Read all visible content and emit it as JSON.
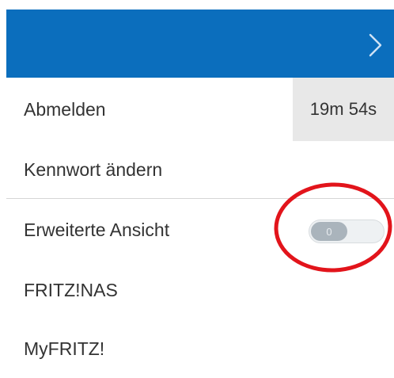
{
  "header": {
    "bg_color": "#0b6ebd",
    "chevron_icon": "chevron-right-icon"
  },
  "menu": {
    "logout_label": "Abmelden",
    "session_timer": "19m 54s",
    "change_password_label": "Kennwort ändern",
    "expert_view_label": "Erweiterte Ansicht",
    "expert_view_toggle_value": "0",
    "nas_label": "FRITZ!NAS",
    "myfritz_label": "MyFRITZ!"
  },
  "annotation": {
    "color": "#e2141b",
    "shape": "ellipse"
  }
}
